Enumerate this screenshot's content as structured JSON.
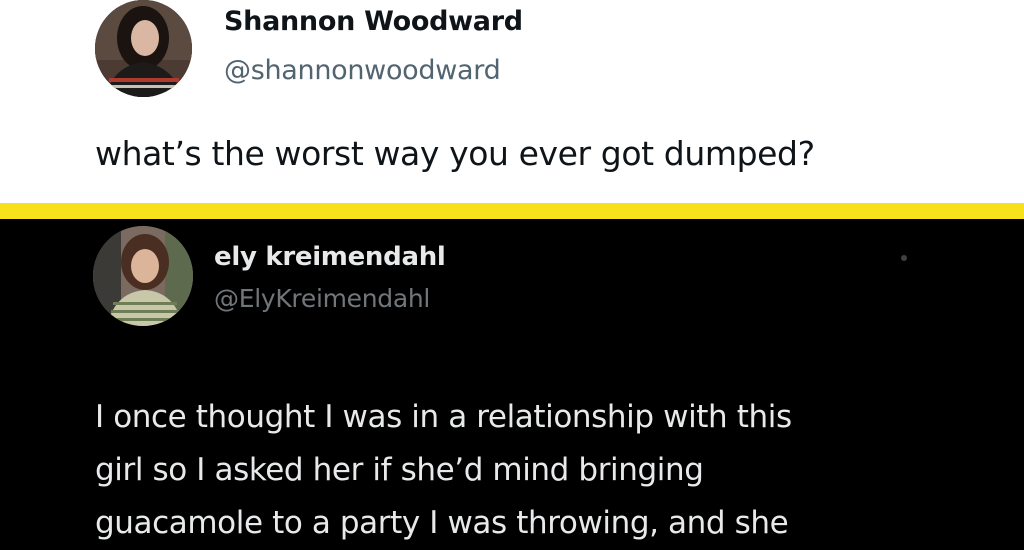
{
  "original_tweet": {
    "display_name": "Shannon Woodward",
    "handle": "@shannonwoodward",
    "text": "what’s the worst way you ever got dumped?"
  },
  "divider_color": "#f6e11c",
  "reply_tweet": {
    "display_name": "ely kreimendahl",
    "handle": "@ElyKreimendahl",
    "more_icon": "more-dot-icon",
    "text_lines": [
      "I once thought I was in a relationship with this",
      "girl so I asked her if she’d mind bringing",
      "guacamole to a party I was throwing, and she"
    ]
  },
  "colors": {
    "light_bg": "#ffffff",
    "dark_bg": "#000000",
    "light_text": "#0f1419",
    "light_secondary": "#536471",
    "dark_text": "#e7e9ea",
    "dark_secondary": "#71767b"
  }
}
